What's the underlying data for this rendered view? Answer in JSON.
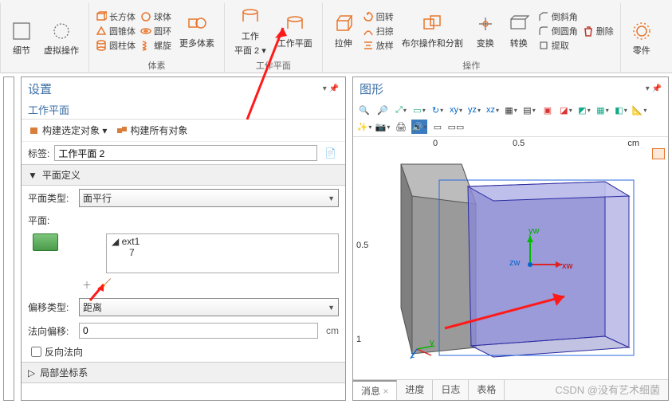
{
  "ribbon": {
    "group_geom": {
      "label": "体素",
      "cuboid": "长方体",
      "sphere": "球体",
      "cone": "圆锥体",
      "torus": "圆环",
      "cylinder": "圆柱体",
      "helix": "螺旋",
      "more": "更多体素"
    },
    "detail": "细节",
    "virtual": "虚拟操作",
    "group_wp": {
      "label": "工作平面",
      "wp1": "工作",
      "wp1b": "平面 2 ▾",
      "wp2": "工作平面"
    },
    "extrude": "拉伸",
    "revolve": "回转",
    "sweep": "扫掠",
    "loft": "放样",
    "bool": "布尔操作和分割",
    "transform": "变换",
    "convert": "转换",
    "chamfer": "倒斜角",
    "delete": "删除",
    "fillet": "倒圆角",
    "extract": "提取",
    "parts": "零件",
    "ops_label": "操作"
  },
  "settings": {
    "title": "设置",
    "subtitle": "工作平面",
    "build_selected": "构建选定对象 ▾",
    "build_all": "构建所有对象",
    "tag_label": "标签:",
    "tag_value": "工作平面 2",
    "sec_plane_def": "平面定义",
    "plane_type_label": "平面类型:",
    "plane_type_value": "面平行",
    "plane_label": "平面:",
    "tree_item1": "ext1",
    "tree_item2": "7",
    "offset_type_label": "偏移类型:",
    "offset_type_value": "距离",
    "normal_offset_label": "法向偏移:",
    "normal_offset_value": "0",
    "unit": "cm",
    "reverse_normal": "反向法向",
    "sec_local_cs": "局部坐标系"
  },
  "graphics": {
    "title": "图形",
    "axis_0a": "0",
    "axis_05a": "0.5",
    "axis_unit": "cm",
    "axis_05b": "0.5",
    "axis_1": "1",
    "yw": "yw",
    "zw": "zw",
    "xw": "xw",
    "y": "y",
    "z": "z"
  },
  "tabs": {
    "msg": "消息",
    "progress": "进度",
    "log": "日志",
    "table": "表格"
  },
  "watermark": "CSDN @没有艺术细菌"
}
